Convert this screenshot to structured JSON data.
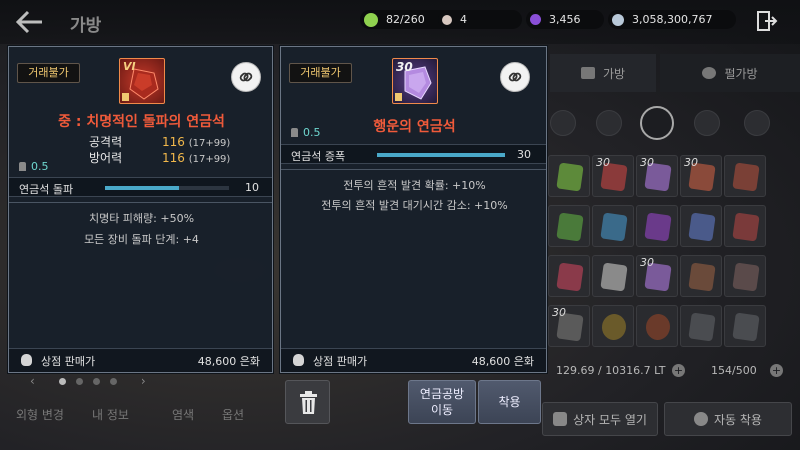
{
  "header": {
    "title": "가방",
    "currencies": [
      {
        "name": "energy",
        "value": "82/260",
        "color": "#8fd14f"
      },
      {
        "name": "pearl",
        "value": "4",
        "color": "#d8c8c0"
      },
      {
        "name": "purple-crystal",
        "value": "3,456",
        "color": "#8a4fd8"
      },
      {
        "name": "silver",
        "value": "3,058,300,767",
        "color": "#b8c8d8"
      }
    ]
  },
  "inventory": {
    "tabs": [
      {
        "label": "가방"
      },
      {
        "label": "펄가방"
      }
    ],
    "weight": "129.69 / 10316.7 LT",
    "slots": "154/500",
    "open_all_label": "상자 모두 열기",
    "auto_equip_label": "자동 착용",
    "stack_counts": [
      "30",
      "30",
      "30",
      "30",
      "30"
    ]
  },
  "bottom_nav": {
    "items": [
      "외형 변경",
      "내 정보",
      "염색",
      "옵션"
    ]
  },
  "card_left": {
    "trade_badge": "거래불가",
    "tier": "VI",
    "name": "중 : 치명적인 돌파의 연금석",
    "stats": [
      {
        "label": "공격력",
        "value": "116",
        "detail": "(17+99)"
      },
      {
        "label": "방어력",
        "value": "116",
        "detail": "(17+99)"
      }
    ],
    "weight": "0.5",
    "bar": {
      "label": "연금석 돌파",
      "value": "10",
      "fill": 0.6
    },
    "effects": [
      "치명타 피해량: +50%",
      "모든 장비 돌파 단계: +4"
    ],
    "sell_label": "상점 판매가",
    "sell_value": "48,600 은화"
  },
  "card_right": {
    "trade_badge": "거래불가",
    "count": "30",
    "name": "행운의 연금석",
    "weight": "0.5",
    "bar": {
      "label": "연금석 증폭",
      "value": "30",
      "fill": 1.0
    },
    "effects": [
      "전투의 흔적 발견 확률: +10%",
      "전투의 흔적 발견 대기시간 감소: +10%"
    ],
    "sell_label": "상점 판매가",
    "sell_value": "48,600 은화"
  },
  "actions": {
    "move_label_1": "연금공방",
    "move_label_2": "이동",
    "equip_label": "착용"
  },
  "colors": {
    "item_name": "#f05a3a",
    "stat_value": "#f2b84b",
    "weight_text": "#6ed6cf",
    "bar_fill": "#4aa9c9",
    "trade_text": "#f0c870"
  }
}
